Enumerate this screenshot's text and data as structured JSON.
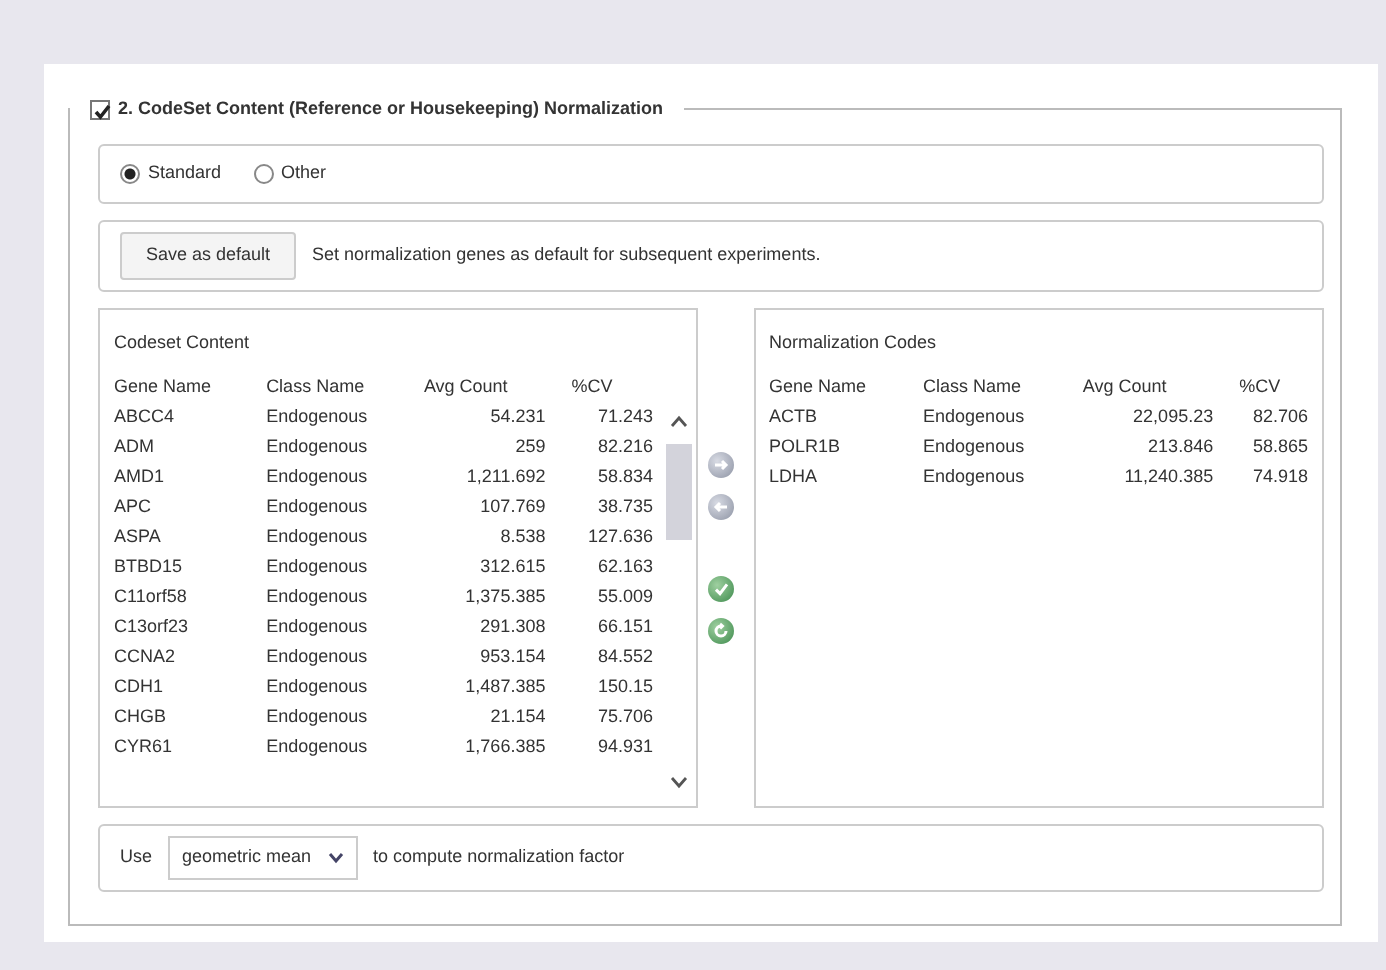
{
  "section": {
    "title": "2. CodeSet Content (Reference or Housekeeping) Normalization",
    "checked": true
  },
  "modes": [
    {
      "label": "Standard",
      "selected": true
    },
    {
      "label": "Other",
      "selected": false
    }
  ],
  "save": {
    "button": "Save as default",
    "description": "Set normalization genes as default for subsequent experiments."
  },
  "codeset_content": {
    "title": "Codeset Content",
    "columns": [
      "Gene Name",
      "Class Name",
      "Avg Count",
      "%CV"
    ],
    "rows": [
      [
        "ABCC4",
        "Endogenous",
        "54.231",
        "71.243"
      ],
      [
        "ADM",
        "Endogenous",
        "259",
        "82.216"
      ],
      [
        "AMD1",
        "Endogenous",
        "1,211.692",
        "58.834"
      ],
      [
        "APC",
        "Endogenous",
        "107.769",
        "38.735"
      ],
      [
        "ASPA",
        "Endogenous",
        "8.538",
        "127.636"
      ],
      [
        "BTBD15",
        "Endogenous",
        "312.615",
        "62.163"
      ],
      [
        "C11orf58",
        "Endogenous",
        "1,375.385",
        "55.009"
      ],
      [
        "C13orf23",
        "Endogenous",
        "291.308",
        "66.151"
      ],
      [
        "CCNA2",
        "Endogenous",
        "953.154",
        "84.552"
      ],
      [
        "CDH1",
        "Endogenous",
        "1,487.385",
        "150.15"
      ],
      [
        "CHGB",
        "Endogenous",
        "21.154",
        "75.706"
      ],
      [
        "CYR61",
        "Endogenous",
        "1,766.385",
        "94.931"
      ]
    ]
  },
  "normalization_codes": {
    "title": "Normalization Codes",
    "columns": [
      "Gene Name",
      "Class Name",
      "Avg Count",
      "%CV"
    ],
    "rows": [
      [
        "ACTB",
        "Endogenous",
        "22,095.23",
        "82.706"
      ],
      [
        "POLR1B",
        "Endogenous",
        "213.846",
        "58.865"
      ],
      [
        "LDHA",
        "Endogenous",
        "11,240.385",
        "74.918"
      ]
    ]
  },
  "compute": {
    "prefix": "Use",
    "method": "geometric mean",
    "suffix": "to compute normalization factor"
  }
}
